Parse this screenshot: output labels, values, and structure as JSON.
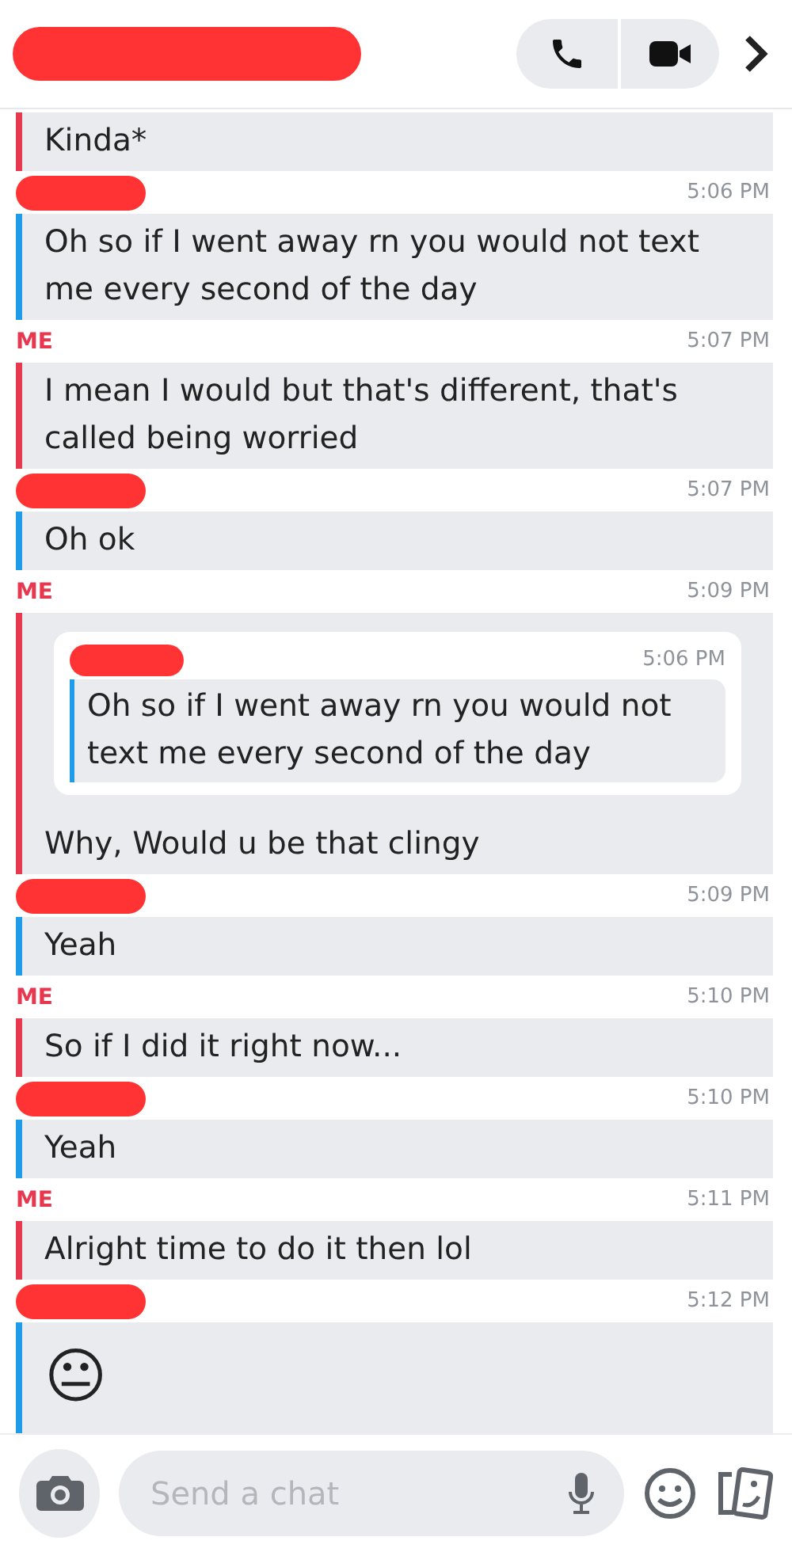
{
  "messages": [
    {
      "kind": "me",
      "text": "Kinda*"
    },
    {
      "kind": "friend",
      "time": "5:06 PM",
      "text": "Oh so if I went away rn you would not text me every second of the day"
    },
    {
      "kind": "me",
      "sender": "ME",
      "time": "5:07 PM",
      "text": "I mean I would but that's different, that's called being worried"
    },
    {
      "kind": "friend",
      "time": "5:07 PM",
      "text": "Oh ok"
    },
    {
      "kind": "me",
      "sender": "ME",
      "time": "5:09 PM",
      "quote": {
        "time": "5:06 PM",
        "text": "Oh so if I went away rn you would not text me every second of the day"
      },
      "text": "Why, Would u be that clingy"
    },
    {
      "kind": "friend",
      "time": "5:09 PM",
      "text": "Yeah"
    },
    {
      "kind": "me",
      "sender": "ME",
      "time": "5:10 PM",
      "text": "So if I did it right now..."
    },
    {
      "kind": "friend",
      "time": "5:10 PM",
      "text": "Yeah"
    },
    {
      "kind": "me",
      "sender": "ME",
      "time": "5:11 PM",
      "text": "Alright time to do it then lol"
    },
    {
      "kind": "friend",
      "time": "5:12 PM",
      "text": "😐",
      "emoji_only": true
    }
  ],
  "composer": {
    "placeholder": "Send a chat"
  }
}
